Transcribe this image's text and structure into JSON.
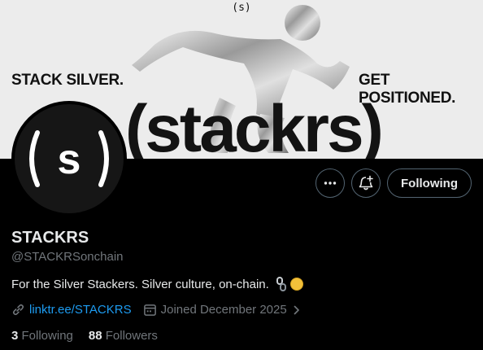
{
  "banner": {
    "top_mark": "(s)",
    "left_text": "STACK SILVER.",
    "right_text": "GET POSITIONED.",
    "wordmark": "(stackrs)"
  },
  "avatar": {
    "glyph": "( s )"
  },
  "actions": {
    "more_icon": "more-horizontal-icon",
    "notify_icon": "bell-plus-icon",
    "follow_label": "Following"
  },
  "profile": {
    "name": "STACKRS",
    "handle": "@STACKRSonchain",
    "bio": "For the Silver Stackers. Silver culture, on-chain.",
    "link": "linktr.ee/STACKRS",
    "joined": "Joined December 2025"
  },
  "stats": {
    "following_count": "3",
    "following_label": "Following",
    "followers_count": "88",
    "followers_label": "Followers"
  },
  "colors": {
    "background": "#000000",
    "link": "#1d9bf0",
    "muted": "#71767b",
    "text": "#e7e9ea"
  }
}
